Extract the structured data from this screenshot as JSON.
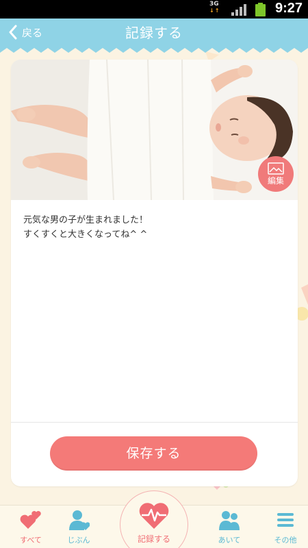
{
  "status_bar": {
    "network": "3G",
    "time": "9:27"
  },
  "header": {
    "back_label": "戻る",
    "title": "記録する"
  },
  "entry": {
    "photo": "sleeping-baby-photo",
    "edit_label": "編集",
    "memo": "元気な男の子が生まれました！\nすくすくと大きくなってね^ ^",
    "save_label": "保存する"
  },
  "bottom_nav": {
    "items": [
      {
        "label": "すべて",
        "icon": "hearts-icon"
      },
      {
        "label": "じぶん",
        "icon": "person-heart-icon"
      },
      {
        "label": "記録する",
        "icon": "heartbeat-icon"
      },
      {
        "label": "あいて",
        "icon": "two-people-icon"
      },
      {
        "label": "その他",
        "icon": "menu-icon"
      }
    ]
  },
  "colors": {
    "header": "#8fd3e6",
    "accent_pink": "#f47a78",
    "nav_blue": "#5bb9d4",
    "background": "#fbf3e2"
  }
}
